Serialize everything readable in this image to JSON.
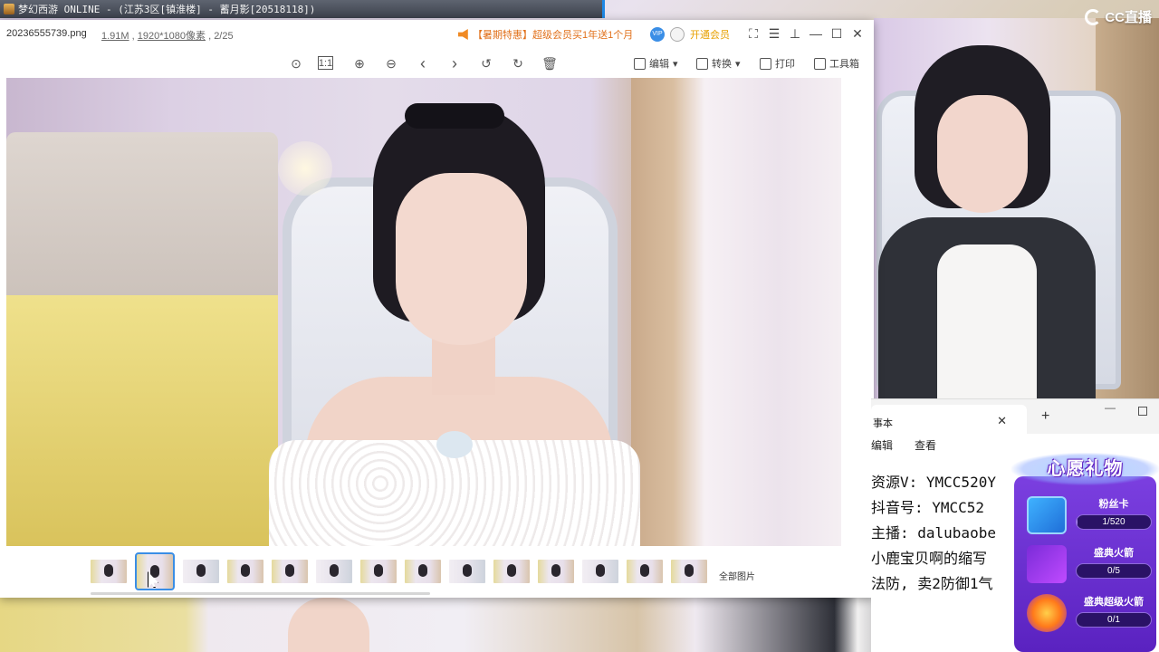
{
  "game_bar": {
    "title": "梦幻西游 ONLINE - (江苏3区[镇淮楼] - 蓄月影[20518118])"
  },
  "overlay": {
    "cc_logo": "CC直播"
  },
  "viewer": {
    "file_name": "20236555739.png",
    "file_size": "1.91M",
    "resolution": "1920*1080像素",
    "position": "2/25",
    "promo_text": "【暑期特惠】超级会员买1年送1个月",
    "vip_button": "开通会员",
    "toolbar": {
      "edit": "编辑",
      "convert": "转换",
      "print": "打印",
      "toolbox": "工具箱"
    },
    "thumbnails_count": 14,
    "selected_thumbnail": 2,
    "all_pictures": "全部图片"
  },
  "notepad": {
    "tab_title": "事本",
    "menu": {
      "edit": "编辑",
      "view": "查看"
    },
    "lines": [
      "资源V: YMCC520Y",
      " 抖音号: YMCC52",
      "主播: dalubaobe",
      "小鹿宝贝啊的缩写",
      "法防, 卖2防御1气"
    ]
  },
  "wish_panel": {
    "title": "心愿礼物",
    "gifts": [
      {
        "name": "粉丝卡",
        "progress": "1/520",
        "ratio": 0.002,
        "icon": "fan-card-icon"
      },
      {
        "name": "盛典火箭",
        "progress": "0/5",
        "ratio": 0,
        "icon": "rocket-icon"
      },
      {
        "name": "盛典超级火箭",
        "progress": "0/1",
        "ratio": 0,
        "icon": "super-rocket-icon"
      }
    ]
  }
}
